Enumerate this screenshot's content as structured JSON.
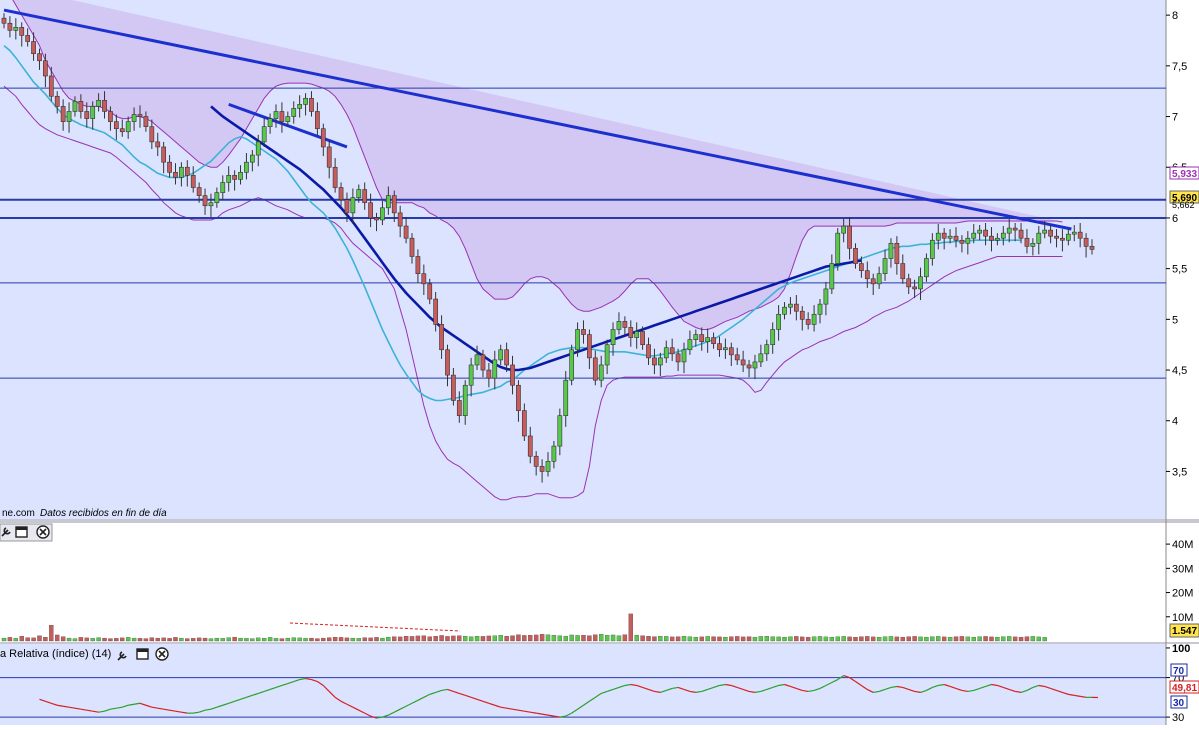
{
  "colors": {
    "panel_bg": "#dbe3ff",
    "bollinger_fill": "#d2c4f2",
    "bollinger_line": "#9a32b4",
    "sma_short": "#3db3d6",
    "sma_long": "#0a1aa6",
    "trendline": "#1c2fcf",
    "hline": "#2a3aa8",
    "up_candle": "#58c84a",
    "down_candle": "#c75c5c",
    "rsi_line_up": "#2aa02a",
    "rsi_line_down": "#d62020"
  },
  "source_text": "ne.com",
  "source_note": "Datos recibidos en fin de día",
  "rsi_label": "a Relativa (índice) (14)",
  "price_badges": {
    "upper": "5,933",
    "last": "5,690",
    "lower": "5,662"
  },
  "volume_badge": "1.547",
  "rsi_badges": {
    "high": "70",
    "value": "49,81",
    "low": "30"
  },
  "toolbar_icons": [
    "wrench-icon",
    "window-icon",
    "close-icon"
  ],
  "chart_data": [
    {
      "type": "candlestick",
      "panel": "price",
      "ylim": [
        3.1,
        8.1
      ],
      "yticks": [
        "3,5",
        "4",
        "4,5",
        "5",
        "5,5",
        "6",
        "6,5",
        "7",
        "7,5",
        "8"
      ],
      "ytick_values": [
        3.5,
        4,
        4.5,
        5,
        5.5,
        6,
        6.5,
        7,
        7.5,
        8
      ],
      "x_count": 180,
      "close": [
        7.92,
        7.85,
        7.88,
        7.8,
        7.74,
        7.62,
        7.55,
        7.4,
        7.2,
        7.1,
        6.95,
        7.05,
        7.15,
        7.05,
        6.98,
        7.1,
        7.16,
        7.05,
        6.95,
        6.88,
        6.85,
        6.95,
        7.02,
        7.0,
        6.9,
        6.75,
        6.7,
        6.55,
        6.45,
        6.4,
        6.5,
        6.42,
        6.3,
        6.22,
        6.12,
        6.15,
        6.25,
        6.35,
        6.42,
        6.38,
        6.45,
        6.55,
        6.62,
        6.75,
        6.9,
        6.98,
        7.05,
        6.95,
        7.0,
        7.08,
        7.12,
        7.18,
        7.05,
        6.88,
        6.7,
        6.5,
        6.3,
        6.18,
        6.05,
        6.2,
        6.28,
        6.15,
        6.0,
        5.98,
        6.1,
        6.22,
        6.05,
        5.92,
        5.8,
        5.62,
        5.45,
        5.35,
        5.2,
        4.95,
        4.7,
        4.45,
        4.2,
        4.05,
        4.35,
        4.55,
        4.65,
        4.5,
        4.42,
        4.6,
        4.7,
        4.55,
        4.35,
        4.1,
        3.85,
        3.65,
        3.55,
        3.5,
        3.6,
        3.75,
        4.05,
        4.4,
        4.7,
        4.9,
        4.85,
        4.62,
        4.4,
        4.55,
        4.75,
        4.9,
        4.98,
        4.92,
        4.82,
        4.88,
        4.75,
        4.62,
        4.55,
        4.62,
        4.72,
        4.66,
        4.58,
        4.7,
        4.8,
        4.85,
        4.78,
        4.82,
        4.76,
        4.7,
        4.72,
        4.65,
        4.6,
        4.55,
        4.52,
        4.58,
        4.66,
        4.75,
        4.9,
        5.05,
        5.12,
        5.15,
        5.08,
        5.0,
        4.95,
        5.05,
        5.15,
        5.3,
        5.55,
        5.85,
        5.92,
        5.7,
        5.55,
        5.48,
        5.4,
        5.35,
        5.45,
        5.6,
        5.75,
        5.55,
        5.4,
        5.32,
        5.3,
        5.42,
        5.6,
        5.78,
        5.85,
        5.8,
        5.82,
        5.78,
        5.75,
        5.8,
        5.85,
        5.88,
        5.82,
        5.78,
        5.8,
        5.85,
        5.9,
        5.88,
        5.8,
        5.72,
        5.75,
        5.85,
        5.88,
        5.82,
        5.8,
        5.78,
        5.84,
        5.86,
        5.8,
        5.72,
        5.69
      ],
      "bollinger_upper": [
        8.3,
        8.2,
        8.1,
        8.0,
        7.9,
        7.8,
        7.7,
        7.55,
        7.45,
        7.35,
        7.25,
        7.18,
        7.15,
        7.12,
        7.1,
        7.1,
        7.1,
        7.08,
        7.05,
        7.0,
        6.98,
        6.98,
        7.0,
        7.0,
        6.98,
        6.95,
        6.9,
        6.85,
        6.8,
        6.75,
        6.7,
        6.65,
        6.6,
        6.55,
        6.52,
        6.5,
        6.5,
        6.55,
        6.62,
        6.7,
        6.78,
        6.88,
        6.98,
        7.08,
        7.18,
        7.25,
        7.3,
        7.32,
        7.33,
        7.33,
        7.33,
        7.33,
        7.32,
        7.3,
        7.28,
        7.25,
        7.2,
        7.12,
        7.02,
        6.9,
        6.75,
        6.6,
        6.45,
        6.3,
        6.18,
        6.15,
        6.15,
        6.15,
        6.15,
        6.15,
        6.12,
        6.1,
        6.05,
        6.02,
        5.98,
        5.95,
        5.9,
        5.82,
        5.7,
        5.55,
        5.4,
        5.3,
        5.25,
        5.2,
        5.2,
        5.2,
        5.22,
        5.28,
        5.35,
        5.4,
        5.42,
        5.42,
        5.4,
        5.35,
        5.3,
        5.22,
        5.15,
        5.1,
        5.08,
        5.08,
        5.1,
        5.12,
        5.15,
        5.18,
        5.22,
        5.28,
        5.35,
        5.4,
        5.4,
        5.4,
        5.35,
        5.28,
        5.2,
        5.12,
        5.05,
        4.98,
        4.95,
        4.92,
        4.9,
        4.9,
        4.92,
        4.95,
        4.98,
        5.0,
        5.02,
        5.05,
        5.08,
        5.1,
        5.12,
        5.15,
        5.18,
        5.22,
        5.3,
        5.45,
        5.62,
        5.78,
        5.88,
        5.92,
        5.92,
        5.92,
        5.92,
        5.92,
        5.92,
        5.92,
        5.92,
        5.92,
        5.92,
        5.92,
        5.92,
        5.92,
        5.93,
        5.95,
        5.95,
        5.95,
        5.95,
        5.95,
        5.95,
        5.95,
        5.95,
        5.95,
        5.95,
        5.95,
        5.96,
        5.97,
        5.97,
        5.97,
        5.97,
        5.97,
        5.97,
        5.97,
        5.97,
        5.97,
        5.97,
        5.97,
        5.97,
        5.97,
        5.97,
        5.97,
        5.97,
        5.96
      ],
      "bollinger_lower": [
        7.3,
        7.25,
        7.2,
        7.12,
        7.05,
        6.98,
        6.92,
        6.88,
        6.85,
        6.82,
        6.8,
        6.78,
        6.76,
        6.74,
        6.72,
        6.7,
        6.68,
        6.66,
        6.64,
        6.6,
        6.55,
        6.5,
        6.45,
        6.4,
        6.35,
        6.28,
        6.22,
        6.15,
        6.1,
        6.05,
        6.02,
        6.0,
        5.98,
        5.98,
        5.98,
        5.98,
        6.0,
        6.05,
        6.08,
        6.1,
        6.12,
        6.15,
        6.18,
        6.2,
        6.18,
        6.15,
        6.12,
        6.1,
        6.08,
        6.05,
        6.02,
        6.0,
        6.0,
        6.0,
        6.0,
        5.98,
        5.95,
        5.9,
        5.82,
        5.75,
        5.7,
        5.65,
        5.6,
        5.55,
        5.5,
        5.4,
        5.3,
        5.1,
        4.9,
        4.65,
        4.4,
        4.15,
        3.95,
        3.8,
        3.7,
        3.62,
        3.58,
        3.55,
        3.5,
        3.45,
        3.4,
        3.35,
        3.3,
        3.25,
        3.22,
        3.22,
        3.24,
        3.25,
        3.25,
        3.26,
        3.28,
        3.28,
        3.28,
        3.26,
        3.24,
        3.24,
        3.24,
        3.26,
        3.3,
        3.55,
        3.95,
        4.2,
        4.35,
        4.4,
        4.42,
        4.43,
        4.43,
        4.43,
        4.43,
        4.43,
        4.43,
        4.43,
        4.44,
        4.44,
        4.45,
        4.45,
        4.45,
        4.45,
        4.45,
        4.45,
        4.45,
        4.45,
        4.44,
        4.43,
        4.42,
        4.4,
        4.35,
        4.28,
        4.3,
        4.38,
        4.45,
        4.52,
        4.58,
        4.62,
        4.66,
        4.7,
        4.72,
        4.75,
        4.78,
        4.8,
        4.82,
        4.85,
        4.88,
        4.9,
        4.92,
        4.95,
        4.98,
        5.02,
        5.05,
        5.08,
        5.1,
        5.12,
        5.15,
        5.18,
        5.22,
        5.26,
        5.3,
        5.34,
        5.38,
        5.42,
        5.45,
        5.48,
        5.5,
        5.52,
        5.54,
        5.56,
        5.58,
        5.6,
        5.62,
        5.62,
        5.62,
        5.62,
        5.62,
        5.62,
        5.62,
        5.62,
        5.62,
        5.62,
        5.62,
        5.62
      ],
      "sma_short": [
        7.7,
        7.65,
        7.58,
        7.5,
        7.42,
        7.34,
        7.28,
        7.22,
        7.15,
        7.08,
        7.02,
        6.98,
        6.95,
        6.92,
        6.9,
        6.88,
        6.86,
        6.84,
        6.8,
        6.76,
        6.72,
        6.66,
        6.6,
        6.55,
        6.52,
        6.48,
        6.44,
        6.42,
        6.4,
        6.4,
        6.4,
        6.42,
        6.44,
        6.48,
        6.52,
        6.56,
        6.62,
        6.68,
        6.74,
        6.78,
        6.8,
        6.78,
        6.74,
        6.7,
        6.66,
        6.62,
        6.58,
        6.52,
        6.46,
        6.38,
        6.3,
        6.22,
        6.15,
        6.1,
        6.05,
        5.98,
        5.9,
        5.8,
        5.7,
        5.58,
        5.45,
        5.32,
        5.18,
        5.04,
        4.9,
        4.78,
        4.66,
        4.55,
        4.46,
        4.38,
        4.3,
        4.25,
        4.22,
        4.2,
        4.2,
        4.21,
        4.22,
        4.23,
        4.25,
        4.26,
        4.27,
        4.28,
        4.3,
        4.32,
        4.34,
        4.38,
        4.4,
        4.45,
        4.5,
        4.54,
        4.58,
        4.62,
        4.66,
        4.68,
        4.7,
        4.71,
        4.72,
        4.72,
        4.72,
        4.71,
        4.7,
        4.69,
        4.68,
        4.68,
        4.68,
        4.68,
        4.67,
        4.66,
        4.65,
        4.64,
        4.64,
        4.65,
        4.66,
        4.67,
        4.68,
        4.7,
        4.72,
        4.74,
        4.76,
        4.78,
        4.8,
        4.84,
        4.88,
        4.92,
        4.96,
        5.0,
        5.05,
        5.1,
        5.15,
        5.2,
        5.25,
        5.3,
        5.33,
        5.36,
        5.38,
        5.4,
        5.42,
        5.44,
        5.46,
        5.48,
        5.5,
        5.52,
        5.54,
        5.56,
        5.58,
        5.6,
        5.62,
        5.64,
        5.66,
        5.68,
        5.7,
        5.71,
        5.72,
        5.72,
        5.73,
        5.74,
        5.74,
        5.75,
        5.75,
        5.76,
        5.76,
        5.77,
        5.77,
        5.77,
        5.78,
        5.78,
        5.78,
        5.78,
        5.78,
        5.78,
        5.78,
        5.78,
        5.78
      ],
      "sma_long": [
        null,
        null,
        null,
        null,
        null,
        null,
        null,
        null,
        null,
        null,
        null,
        null,
        null,
        null,
        null,
        null,
        null,
        null,
        null,
        null,
        null,
        null,
        null,
        null,
        null,
        null,
        null,
        null,
        null,
        null,
        null,
        null,
        null,
        null,
        null,
        7.1,
        7.05,
        7.0,
        6.96,
        6.92,
        6.88,
        6.84,
        6.8,
        6.76,
        6.72,
        6.68,
        6.64,
        6.6,
        6.56,
        6.52,
        6.48,
        6.43,
        6.38,
        6.33,
        6.28,
        6.22,
        6.16,
        6.1,
        6.03,
        5.96,
        5.88,
        5.8,
        5.72,
        5.64,
        5.56,
        5.48,
        5.4,
        5.33,
        5.26,
        5.2,
        5.14,
        5.08,
        5.02,
        4.97,
        4.92,
        4.88,
        4.84,
        4.8,
        4.76,
        4.72,
        4.68,
        4.64,
        4.6,
        4.56,
        4.53,
        4.51,
        4.5,
        4.5,
        4.51,
        4.52,
        4.54,
        4.56,
        4.58,
        4.6,
        4.62,
        4.64,
        4.66,
        4.68,
        4.7,
        4.72,
        4.74,
        4.76,
        4.78,
        4.8,
        4.82,
        4.84,
        4.86,
        4.88,
        4.9,
        4.92,
        4.94,
        4.96,
        4.98,
        5.0,
        5.02,
        5.04,
        5.06,
        5.08,
        5.1,
        5.12,
        5.14,
        5.16,
        5.18,
        5.2,
        5.22,
        5.24,
        5.26,
        5.28,
        5.3,
        5.32,
        5.34,
        5.36,
        5.38,
        5.4,
        5.42,
        5.44,
        5.46,
        5.48,
        5.5,
        5.52,
        5.53,
        5.54,
        5.55,
        5.56,
        5.57,
        5.58
      ],
      "trendlines": [
        {
          "x": [
            0,
            168
          ],
          "y": [
            8.05,
            5.95
          ]
        },
        {
          "x": [
            38,
            58
          ],
          "y": [
            7.12,
            6.7
          ]
        }
      ],
      "hlines": [
        7.28,
        6.18,
        6.0,
        5.36,
        4.42
      ],
      "hline_widths": [
        1,
        2,
        2,
        1,
        1
      ]
    },
    {
      "type": "bar",
      "panel": "volume",
      "yticks": [
        "10M",
        "20M",
        "30M",
        "40M"
      ],
      "ytick_values": [
        10,
        20,
        30,
        40
      ],
      "ylim": [
        0,
        45
      ],
      "unit": "M",
      "values": [
        1.2,
        1.5,
        1.1,
        2.0,
        1.4,
        1.3,
        2.2,
        1.6,
        6.5,
        2.5,
        1.8,
        1.2,
        1.0,
        1.5,
        1.3,
        1.1,
        1.4,
        1.2,
        1.0,
        1.1,
        1.3,
        1.5,
        1.2,
        1.1,
        1.0,
        1.4,
        1.2,
        1.3,
        1.1,
        1.5,
        1.2,
        1.0,
        1.1,
        1.3,
        1.2,
        1.0,
        1.2,
        1.1,
        1.4,
        1.6,
        1.2,
        1.1,
        1.0,
        1.3,
        1.2,
        1.5,
        1.1,
        1.0,
        1.2,
        1.4,
        1.3,
        1.1,
        1.2,
        1.0,
        1.2,
        1.4,
        1.6,
        1.5,
        1.3,
        1.2,
        1.1,
        1.4,
        1.3,
        1.5,
        1.2,
        1.6,
        1.8,
        1.7,
        2.0,
        1.9,
        2.1,
        2.2,
        1.8,
        2.0,
        2.3,
        1.9,
        2.1,
        2.2,
        2.0,
        1.8,
        2.0,
        1.9,
        2.1,
        2.2,
        2.4,
        2.0,
        2.2,
        2.6,
        2.3,
        2.4,
        2.5,
        2.8,
        2.6,
        2.4,
        2.2,
        2.0,
        2.5,
        2.3,
        2.4,
        2.2,
        2.6,
        2.8,
        2.4,
        2.5,
        2.2,
        2.6,
        11.2,
        2.4,
        2.2,
        2.0,
        1.8,
        2.0,
        1.9,
        1.7,
        1.8,
        2.0,
        1.8,
        1.6,
        1.7,
        1.9,
        1.8,
        1.7,
        1.6,
        1.8,
        1.9,
        1.7,
        1.8,
        1.6,
        1.9,
        2.0,
        1.8,
        1.7,
        1.6,
        1.8,
        1.9,
        1.7,
        1.6,
        1.8,
        1.9,
        1.7,
        1.6,
        1.8,
        1.9,
        1.7,
        1.6,
        1.8,
        1.9,
        1.7,
        1.6,
        1.8,
        1.9,
        1.7,
        1.6,
        1.8,
        1.9,
        1.7,
        1.6,
        1.8,
        1.9,
        1.7,
        1.6,
        1.8,
        1.9,
        1.7,
        1.6,
        1.8,
        1.9,
        1.7,
        1.6,
        1.8,
        1.9,
        1.7,
        1.6,
        1.8,
        1.9,
        1.7,
        1.5
      ]
    },
    {
      "type": "line",
      "panel": "rsi",
      "title": "a Relativa (índice) (14)",
      "ylim": [
        22,
        104
      ],
      "yticks": [
        "30",
        "70",
        "100"
      ],
      "ytick_values": [
        30,
        70,
        100
      ],
      "values": [
        48,
        46,
        44,
        42,
        41,
        40,
        39,
        38,
        37,
        36,
        35,
        36,
        38,
        39,
        40,
        42,
        43,
        44,
        42,
        40,
        39,
        38,
        37,
        36,
        35,
        34,
        34,
        35,
        37,
        38,
        40,
        42,
        44,
        46,
        48,
        50,
        52,
        54,
        56,
        58,
        60,
        62,
        64,
        66,
        68,
        69,
        68,
        66,
        62,
        56,
        50,
        46,
        43,
        40,
        37,
        34,
        31,
        29,
        30,
        32,
        35,
        38,
        41,
        44,
        47,
        50,
        53,
        55,
        57,
        58,
        56,
        54,
        52,
        50,
        48,
        46,
        44,
        42,
        40,
        39,
        38,
        37,
        36,
        35,
        34,
        33,
        32,
        31,
        30,
        31,
        34,
        38,
        42,
        46,
        50,
        54,
        56,
        58,
        60,
        62,
        63,
        62,
        60,
        58,
        56,
        55,
        57,
        59,
        60,
        58,
        56,
        55,
        56,
        58,
        60,
        62,
        63,
        62,
        60,
        58,
        56,
        55,
        56,
        58,
        60,
        62,
        63,
        61,
        59,
        57,
        56,
        57,
        59,
        62,
        65,
        68,
        72,
        70,
        66,
        62,
        58,
        55,
        56,
        58,
        60,
        61,
        60,
        58,
        56,
        55,
        57,
        60,
        62,
        63,
        61,
        59,
        57,
        56,
        57,
        59,
        61,
        63,
        62,
        60,
        58,
        56,
        55,
        57,
        60,
        62,
        61,
        59,
        57,
        55,
        53,
        52,
        51,
        50,
        50,
        49.81
      ]
    }
  ]
}
